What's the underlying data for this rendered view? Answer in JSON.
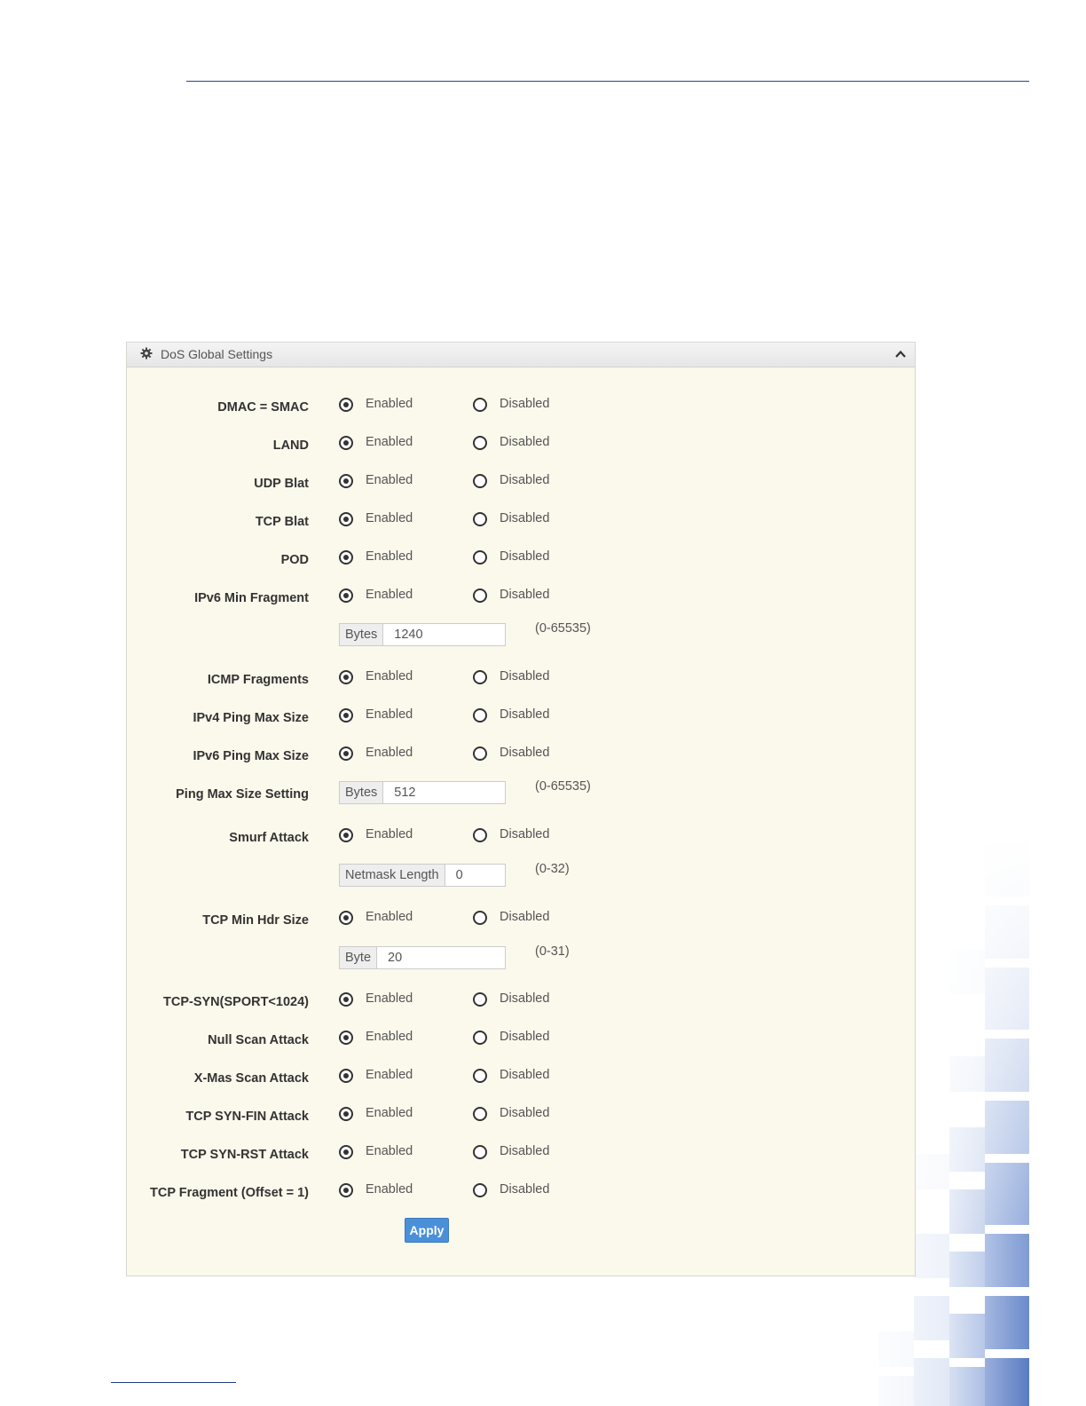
{
  "panel": {
    "title": "DoS Global Settings",
    "icon": "gear-icon",
    "collapse_icon": "chevron-up-icon"
  },
  "options": {
    "enabled": "Enabled",
    "disabled": "Disabled"
  },
  "rows": [
    {
      "id": "dmac-smac",
      "label": "DMAC = SMAC",
      "selected": "Enabled"
    },
    {
      "id": "land",
      "label": "LAND",
      "selected": "Enabled"
    },
    {
      "id": "udp-blat",
      "label": "UDP Blat",
      "selected": "Enabled"
    },
    {
      "id": "tcp-blat",
      "label": "TCP Blat",
      "selected": "Enabled"
    },
    {
      "id": "pod",
      "label": "POD",
      "selected": "Enabled"
    },
    {
      "id": "ipv6-min-fragment",
      "label": "IPv6 Min Fragment",
      "selected": "Enabled"
    },
    {
      "id": "ipv6-min-fragment-bytes",
      "addon": "Bytes",
      "value": "1240",
      "range": "(0-65535)"
    },
    {
      "id": "icmp-fragments",
      "label": "ICMP Fragments",
      "selected": "Enabled"
    },
    {
      "id": "ipv4-ping-max-size",
      "label": "IPv4 Ping Max Size",
      "selected": "Enabled"
    },
    {
      "id": "ipv6-ping-max-size",
      "label": "IPv6 Ping Max Size",
      "selected": "Enabled"
    },
    {
      "id": "ping-max-size-setting",
      "label": "Ping Max Size Setting",
      "addon": "Bytes",
      "value": "512",
      "range": "(0-65535)"
    },
    {
      "id": "smurf-attack",
      "label": "Smurf Attack",
      "selected": "Enabled"
    },
    {
      "id": "smurf-netmask",
      "addon": "Netmask Length",
      "value": "0",
      "range": "(0-32)"
    },
    {
      "id": "tcp-min-hdr-size",
      "label": "TCP Min Hdr Size",
      "selected": "Enabled"
    },
    {
      "id": "tcp-min-hdr-byte",
      "addon": "Byte",
      "value": "20",
      "range": "(0-31)"
    },
    {
      "id": "tcp-syn-sport",
      "label": "TCP-SYN(SPORT<1024)",
      "selected": "Enabled"
    },
    {
      "id": "null-scan-attack",
      "label": "Null Scan Attack",
      "selected": "Enabled"
    },
    {
      "id": "xmas-scan-attack",
      "label": "X-Mas Scan Attack",
      "selected": "Enabled"
    },
    {
      "id": "tcp-syn-fin-attack",
      "label": "TCP SYN-FIN Attack",
      "selected": "Enabled"
    },
    {
      "id": "tcp-syn-rst-attack",
      "label": "TCP SYN-RST Attack",
      "selected": "Enabled"
    },
    {
      "id": "tcp-fragment-offset",
      "label": "TCP Fragment (Offset = 1)",
      "selected": "Enabled"
    }
  ],
  "apply_label": "Apply",
  "colors": {
    "accent": "#4a90d9",
    "panel_bg": "#fbf8ec",
    "rule": "#1f4e79"
  }
}
